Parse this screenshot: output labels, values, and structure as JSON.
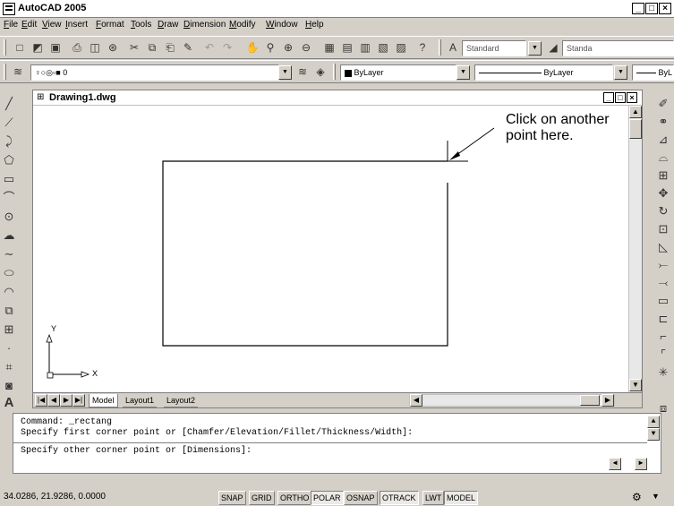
{
  "window": {
    "title": "AutoCAD 2005",
    "minimize": "_",
    "restore": "□",
    "close": "×"
  },
  "menu": [
    "File",
    "Edit",
    "View",
    "Insert",
    "Format",
    "Tools",
    "Draw",
    "Dimension",
    "Modify",
    "Window",
    "Help"
  ],
  "toolbar": {
    "text_style": "Standard",
    "dim_style": "Standa",
    "layer": "0",
    "color": "ByLayer",
    "linetype": "ByLayer",
    "lineweight": "ByL"
  },
  "drawing": {
    "title": "Drawing1.dwg",
    "annotation": "Click on another point here.",
    "annotation_line1": "Click on another",
    "annotation_line2": "point here.",
    "ucs_x": "X",
    "ucs_y": "Y",
    "tabs": [
      "Model",
      "Layout1",
      "Layout2"
    ]
  },
  "command": {
    "lines": [
      "Command: _rectang",
      "Specify first corner point or [Chamfer/Elevation/Fillet/Thickness/Width]:",
      "Specify other corner point or [Dimensions]:"
    ]
  },
  "status": {
    "coords": "34.0286, 21.9286, 0.0000",
    "buttons": [
      {
        "label": "SNAP",
        "on": false
      },
      {
        "label": "GRID",
        "on": false
      },
      {
        "label": "ORTHO",
        "on": false
      },
      {
        "label": "POLAR",
        "on": true
      },
      {
        "label": "OSNAP",
        "on": false
      },
      {
        "label": "OTRACK",
        "on": true
      },
      {
        "label": "LWT",
        "on": false
      },
      {
        "label": "MODEL",
        "on": true
      }
    ]
  }
}
